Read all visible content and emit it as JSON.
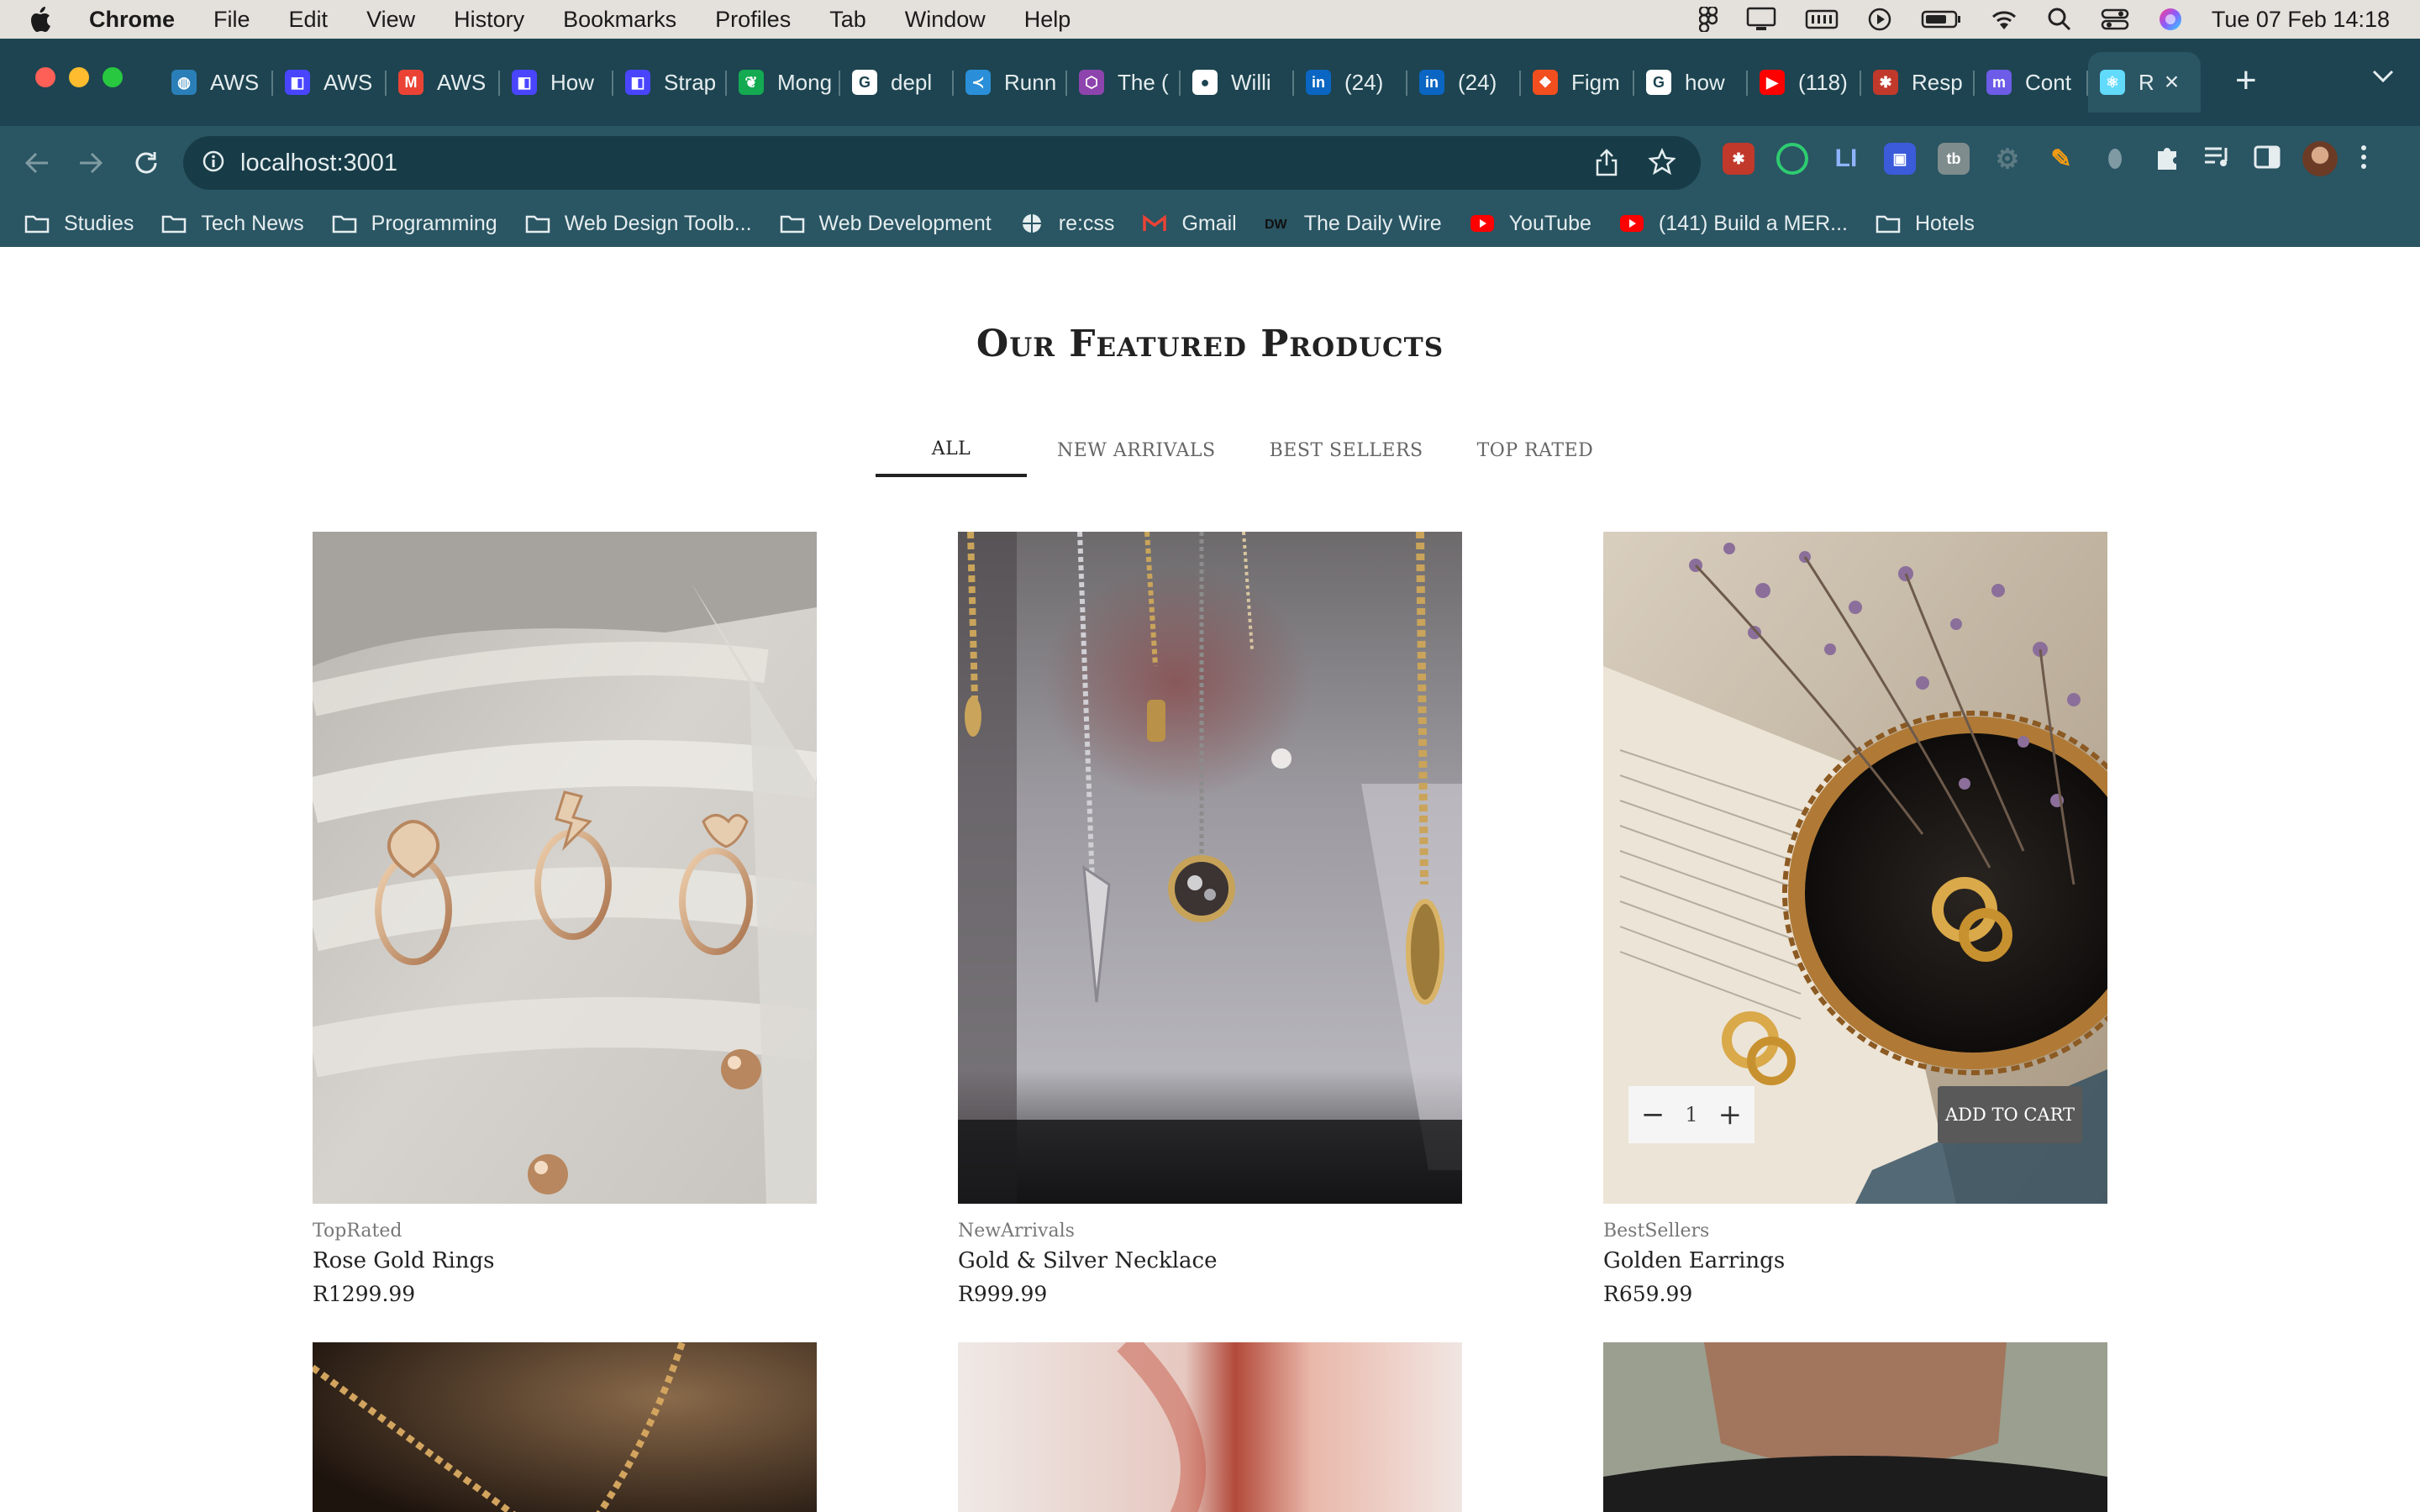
{
  "menubar": {
    "app": "Chrome",
    "items": [
      "File",
      "Edit",
      "View",
      "History",
      "Bookmarks",
      "Profiles",
      "Tab",
      "Window",
      "Help"
    ],
    "datetime": "Tue 07 Feb  14:18"
  },
  "tabs": [
    {
      "label": "AWS",
      "icon": "globe-icon",
      "color": "#2b7fb8"
    },
    {
      "label": "AWS",
      "icon": "app-icon",
      "color": "#4945ff"
    },
    {
      "label": "AWS",
      "icon": "gmail-icon",
      "color": "#ea4335"
    },
    {
      "label": "How",
      "icon": "app-icon",
      "color": "#4945ff"
    },
    {
      "label": "Strap",
      "icon": "app-icon",
      "color": "#4945ff"
    },
    {
      "label": "Mong",
      "icon": "leaf-icon",
      "color": "#13aa52"
    },
    {
      "label": "depl",
      "icon": "google-icon",
      "color": "#ffffff"
    },
    {
      "label": "Runn",
      "icon": "vscode-icon",
      "color": "#2a8fd8"
    },
    {
      "label": "The (",
      "icon": "shield-icon",
      "color": "#8e44ad"
    },
    {
      "label": "Willi",
      "icon": "github-icon",
      "color": "#ffffff"
    },
    {
      "label": "(24)",
      "icon": "linkedin-icon",
      "color": "#0a66c2"
    },
    {
      "label": "(24)",
      "icon": "linkedin-icon",
      "color": "#0a66c2"
    },
    {
      "label": "Figm",
      "icon": "figma-icon",
      "color": "#f24e1e"
    },
    {
      "label": "how",
      "icon": "google-icon",
      "color": "#ffffff"
    },
    {
      "label": "(118)",
      "icon": "youtube-icon",
      "color": "#ff0000"
    },
    {
      "label": "Resp",
      "icon": "bug-icon",
      "color": "#c0392b"
    },
    {
      "label": "Cont",
      "icon": "m-icon",
      "color": "#6c5ce7"
    },
    {
      "label": "R",
      "icon": "react-icon",
      "color": "#61dafb",
      "active": true
    }
  ],
  "address": {
    "url": "localhost:3001"
  },
  "bookmarks": [
    {
      "label": "Studies",
      "icon": "folder-icon"
    },
    {
      "label": "Tech News",
      "icon": "folder-icon"
    },
    {
      "label": "Programming",
      "icon": "folder-icon"
    },
    {
      "label": "Web Design Toolb...",
      "icon": "folder-icon"
    },
    {
      "label": "Web Development",
      "icon": "folder-icon"
    },
    {
      "label": "re:css",
      "icon": "globe-icon"
    },
    {
      "label": "Gmail",
      "icon": "gmail-icon"
    },
    {
      "label": "The Daily Wire",
      "icon": "dw-icon"
    },
    {
      "label": "YouTube",
      "icon": "youtube-icon"
    },
    {
      "label": "(141) Build a MER...",
      "icon": "youtube-icon"
    },
    {
      "label": "Hotels",
      "icon": "folder-icon"
    }
  ],
  "section": {
    "title_light": "Our Featured",
    "title_bold": "Products"
  },
  "filters": [
    "ALL",
    "NEW ARRIVALS",
    "BEST SELLERS",
    "TOP RATED"
  ],
  "products": [
    {
      "category": "TopRated",
      "name": "Rose Gold Rings",
      "price": "R1299.99"
    },
    {
      "category": "NewArrivals",
      "name": "Gold & Silver Necklace",
      "price": "R999.99"
    },
    {
      "category": "BestSellers",
      "name": "Golden Earrings",
      "price": "R659.99",
      "quantity": "1",
      "add_to_cart": "ADD TO CART"
    }
  ],
  "colors": {
    "chrome_frame": "#1d4450",
    "chrome_toolbar": "#2a5563",
    "page_bg": "#ffffff"
  }
}
